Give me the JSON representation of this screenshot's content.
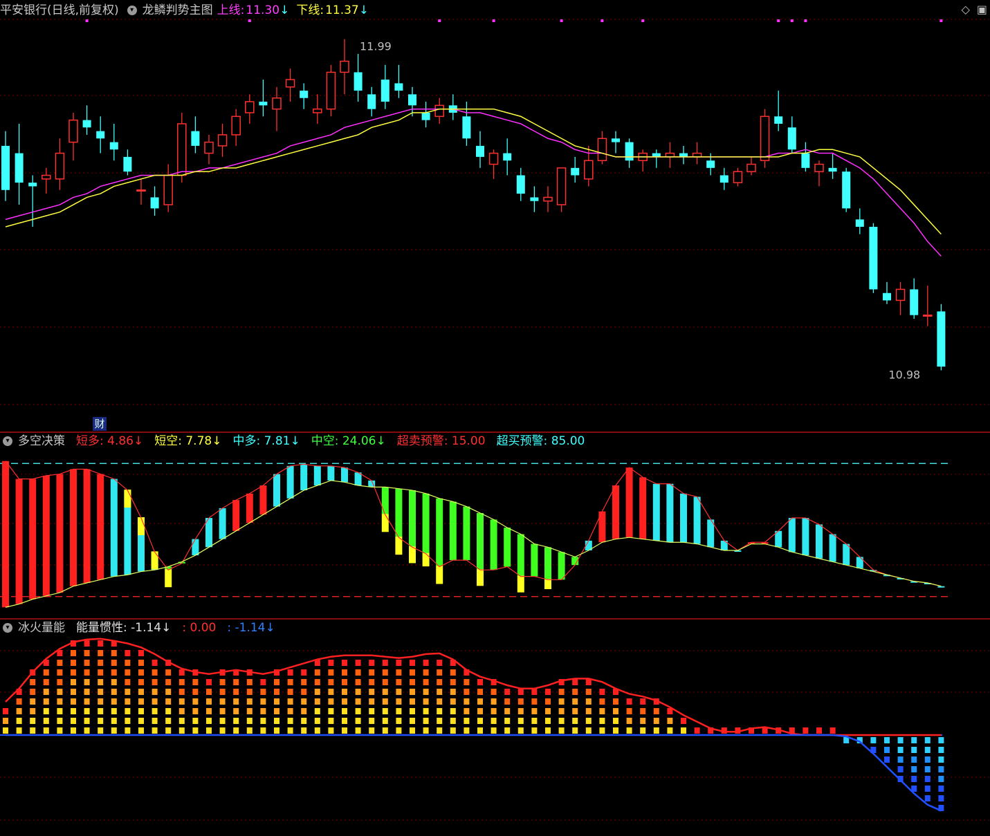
{
  "main_header": {
    "stock": "平安银行(日线,前复权)",
    "indicator": "龙鳞判势主图",
    "upper_label": "上线:",
    "upper_value": "11.30",
    "lower_label": "下线:",
    "lower_value": "11.37",
    "arrow": "↓"
  },
  "badge": "财",
  "sub1_header": {
    "name": "多空决策",
    "items": [
      {
        "label": "短多:",
        "value": "4.86",
        "arrow": "↓",
        "color": "#ff3030"
      },
      {
        "label": "短空:",
        "value": "7.78",
        "arrow": "↓",
        "color": "#ffff40"
      },
      {
        "label": "中多:",
        "value": "7.81",
        "arrow": "↓",
        "color": "#40ffff"
      },
      {
        "label": "中空:",
        "value": "24.06",
        "arrow": "↓",
        "color": "#40ff40"
      },
      {
        "label": "超卖预警:",
        "value": "15.00",
        "arrow": "",
        "color": "#ff3030"
      },
      {
        "label": "超买预警:",
        "value": "85.00",
        "arrow": "",
        "color": "#40ffff"
      }
    ]
  },
  "sub2_header": {
    "name": "冰火量能",
    "items": [
      {
        "label": "能量惯性:",
        "value": "-1.14",
        "arrow": "↓",
        "color": "#e0e0e0"
      },
      {
        "label": ":",
        "value": "0.00",
        "arrow": "",
        "color": "#ff3030"
      },
      {
        "label": ":",
        "value": "-1.14",
        "arrow": "↓",
        "color": "#3080ff"
      }
    ]
  },
  "colors": {
    "up": "#ff3030",
    "down": "#40ffff",
    "ma1": "#ff30ff",
    "ma2": "#ffff40",
    "grid": "#8b0000"
  },
  "chart_data": [
    {
      "type": "candlestick",
      "title": "龙鳞判势主图",
      "high_label": "11.99",
      "low_label": "10.98",
      "ohlc": [
        [
          11.7,
          11.74,
          11.55,
          11.58
        ],
        [
          11.68,
          11.76,
          11.54,
          11.6
        ],
        [
          11.6,
          11.62,
          11.48,
          11.59
        ],
        [
          11.61,
          11.64,
          11.57,
          11.62
        ],
        [
          11.61,
          11.72,
          11.58,
          11.68
        ],
        [
          11.71,
          11.79,
          11.66,
          11.77
        ],
        [
          11.77,
          11.81,
          11.73,
          11.75
        ],
        [
          11.74,
          11.78,
          11.68,
          11.72
        ],
        [
          11.71,
          11.76,
          11.66,
          11.69
        ],
        [
          11.67,
          11.69,
          11.62,
          11.63
        ],
        [
          11.58,
          11.61,
          11.54,
          11.58
        ],
        [
          11.56,
          11.59,
          11.51,
          11.53
        ],
        [
          11.54,
          11.65,
          11.52,
          11.62
        ],
        [
          11.62,
          11.79,
          11.6,
          11.76
        ],
        [
          11.74,
          11.78,
          11.68,
          11.7
        ],
        [
          11.68,
          11.73,
          11.65,
          11.71
        ],
        [
          11.7,
          11.76,
          11.67,
          11.73
        ],
        [
          11.73,
          11.8,
          11.7,
          11.78
        ],
        [
          11.79,
          11.84,
          11.76,
          11.82
        ],
        [
          11.82,
          11.88,
          11.78,
          11.81
        ],
        [
          11.8,
          11.86,
          11.74,
          11.83
        ],
        [
          11.86,
          11.91,
          11.82,
          11.88
        ],
        [
          11.85,
          11.87,
          11.8,
          11.83
        ],
        [
          11.79,
          11.84,
          11.76,
          11.8
        ],
        [
          11.8,
          11.92,
          11.78,
          11.9
        ],
        [
          11.9,
          11.99,
          11.84,
          11.93
        ],
        [
          11.9,
          11.95,
          11.82,
          11.85
        ],
        [
          11.84,
          11.86,
          11.78,
          11.8
        ],
        [
          11.88,
          11.92,
          11.8,
          11.82
        ],
        [
          11.87,
          11.92,
          11.83,
          11.85
        ],
        [
          11.84,
          11.86,
          11.78,
          11.81
        ],
        [
          11.79,
          11.82,
          11.75,
          11.77
        ],
        [
          11.78,
          11.83,
          11.76,
          11.81
        ],
        [
          11.81,
          11.84,
          11.77,
          11.79
        ],
        [
          11.78,
          11.82,
          11.7,
          11.72
        ],
        [
          11.7,
          11.74,
          11.64,
          11.67
        ],
        [
          11.65,
          11.69,
          11.61,
          11.68
        ],
        [
          11.68,
          11.72,
          11.62,
          11.66
        ],
        [
          11.62,
          11.64,
          11.55,
          11.57
        ],
        [
          11.56,
          11.59,
          11.52,
          11.55
        ],
        [
          11.55,
          11.59,
          11.52,
          11.56
        ],
        [
          11.54,
          11.64,
          11.52,
          11.64
        ],
        [
          11.64,
          11.67,
          11.6,
          11.62
        ],
        [
          11.61,
          11.7,
          11.59,
          11.66
        ],
        [
          11.66,
          11.74,
          11.65,
          11.72
        ],
        [
          11.72,
          11.74,
          11.68,
          11.71
        ],
        [
          11.71,
          11.72,
          11.64,
          11.66
        ],
        [
          11.66,
          11.69,
          11.63,
          11.68
        ],
        [
          11.68,
          11.69,
          11.64,
          11.67
        ],
        [
          11.67,
          11.71,
          11.64,
          11.68
        ],
        [
          11.68,
          11.7,
          11.65,
          11.67
        ],
        [
          11.67,
          11.71,
          11.65,
          11.68
        ],
        [
          11.66,
          11.68,
          11.62,
          11.64
        ],
        [
          11.62,
          11.64,
          11.58,
          11.6
        ],
        [
          11.6,
          11.64,
          11.59,
          11.63
        ],
        [
          11.63,
          11.67,
          11.62,
          11.65
        ],
        [
          11.66,
          11.8,
          11.64,
          11.78
        ],
        [
          11.78,
          11.85,
          11.74,
          11.76
        ],
        [
          11.75,
          11.78,
          11.68,
          11.69
        ],
        [
          11.68,
          11.71,
          11.63,
          11.64
        ],
        [
          11.63,
          11.66,
          11.59,
          11.65
        ],
        [
          11.64,
          11.68,
          11.61,
          11.63
        ],
        [
          11.63,
          11.64,
          11.52,
          11.53
        ],
        [
          11.5,
          11.53,
          11.46,
          11.48
        ],
        [
          11.48,
          11.49,
          11.3,
          11.31
        ],
        [
          11.3,
          11.33,
          11.27,
          11.28
        ],
        [
          11.28,
          11.33,
          11.24,
          11.31
        ],
        [
          11.31,
          11.34,
          11.23,
          11.24
        ],
        [
          11.24,
          11.32,
          11.21,
          11.24
        ],
        [
          11.25,
          11.27,
          11.09,
          11.1
        ]
      ],
      "ma_fast": [
        11.5,
        11.51,
        11.52,
        11.53,
        11.54,
        11.56,
        11.57,
        11.59,
        11.6,
        11.61,
        11.62,
        11.62,
        11.62,
        11.63,
        11.63,
        11.64,
        11.64,
        11.65,
        11.66,
        11.67,
        11.68,
        11.7,
        11.71,
        11.72,
        11.73,
        11.75,
        11.76,
        11.77,
        11.78,
        11.79,
        11.8,
        11.8,
        11.8,
        11.8,
        11.79,
        11.79,
        11.78,
        11.77,
        11.76,
        11.74,
        11.72,
        11.71,
        11.69,
        11.68,
        11.68,
        11.67,
        11.67,
        11.67,
        11.67,
        11.67,
        11.67,
        11.67,
        11.67,
        11.67,
        11.67,
        11.67,
        11.67,
        11.68,
        11.68,
        11.69,
        11.68,
        11.68,
        11.66,
        11.64,
        11.61,
        11.57,
        11.53,
        11.49,
        11.44,
        11.4
      ],
      "ma_slow": [
        11.48,
        11.49,
        11.5,
        11.51,
        11.52,
        11.54,
        11.56,
        11.57,
        11.59,
        11.6,
        11.61,
        11.62,
        11.62,
        11.62,
        11.63,
        11.63,
        11.64,
        11.64,
        11.65,
        11.66,
        11.67,
        11.68,
        11.69,
        11.7,
        11.71,
        11.72,
        11.73,
        11.75,
        11.76,
        11.77,
        11.79,
        11.79,
        11.8,
        11.8,
        11.8,
        11.8,
        11.8,
        11.79,
        11.78,
        11.76,
        11.74,
        11.72,
        11.7,
        11.69,
        11.68,
        11.67,
        11.67,
        11.67,
        11.67,
        11.67,
        11.67,
        11.67,
        11.67,
        11.67,
        11.67,
        11.67,
        11.67,
        11.67,
        11.68,
        11.68,
        11.69,
        11.69,
        11.68,
        11.67,
        11.64,
        11.61,
        11.58,
        11.54,
        11.5,
        11.46
      ],
      "ylim": [
        10.95,
        12.04
      ]
    },
    {
      "type": "bar",
      "title": "多空决策",
      "fast": [
        95,
        84,
        84,
        86,
        87,
        90,
        90,
        87,
        84,
        77,
        60,
        39,
        28,
        32,
        47,
        60,
        66,
        71,
        75,
        80,
        87,
        92,
        93,
        92,
        92,
        91,
        88,
        83,
        62,
        48,
        42,
        38,
        30,
        34,
        34,
        28,
        28,
        30,
        24,
        24,
        22,
        22,
        31,
        46,
        64,
        80,
        91,
        85,
        81,
        81,
        75,
        73,
        59,
        46,
        40,
        45,
        45,
        52,
        60,
        60,
        56,
        50,
        44,
        36,
        28,
        25,
        23,
        21,
        20,
        18
      ],
      "slow": [
        5,
        7,
        10,
        12,
        14,
        18,
        20,
        22,
        24,
        25,
        27,
        28,
        30,
        33,
        37,
        42,
        47,
        52,
        57,
        62,
        67,
        72,
        77,
        80,
        83,
        82,
        80,
        79,
        79,
        78,
        77,
        75,
        72,
        70,
        67,
        63,
        59,
        54,
        50,
        44,
        42,
        39,
        36,
        40,
        45,
        47,
        48,
        47,
        46,
        45,
        45,
        44,
        42,
        40,
        40,
        44,
        44,
        42,
        39,
        37,
        35,
        33,
        31,
        29,
        27,
        25,
        23,
        21,
        20,
        18
      ],
      "oversold": 15,
      "overbought": 85,
      "ylim": [
        0,
        100
      ]
    },
    {
      "type": "bar",
      "title": "冰火量能",
      "values": [
        0.5,
        0.7,
        0.95,
        1.15,
        1.3,
        1.4,
        1.44,
        1.45,
        1.42,
        1.38,
        1.32,
        1.22,
        1.1,
        1.0,
        0.95,
        0.92,
        0.95,
        0.98,
        0.95,
        0.92,
        0.96,
        1.02,
        1.08,
        1.14,
        1.18,
        1.2,
        1.2,
        1.2,
        1.18,
        1.16,
        1.18,
        1.22,
        1.23,
        1.14,
        0.98,
        0.88,
        0.82,
        0.75,
        0.7,
        0.7,
        0.75,
        0.82,
        0.85,
        0.85,
        0.8,
        0.7,
        0.62,
        0.58,
        0.52,
        0.42,
        0.3,
        0.2,
        0.1,
        0.05,
        0.05,
        0.1,
        0.12,
        0.08,
        0.02,
        0.0,
        0.0,
        0.0,
        -0.02,
        -0.1,
        -0.28,
        -0.48,
        -0.68,
        -0.88,
        -1.05,
        -1.14
      ],
      "ylim": [
        -1.6,
        1.6
      ]
    }
  ]
}
